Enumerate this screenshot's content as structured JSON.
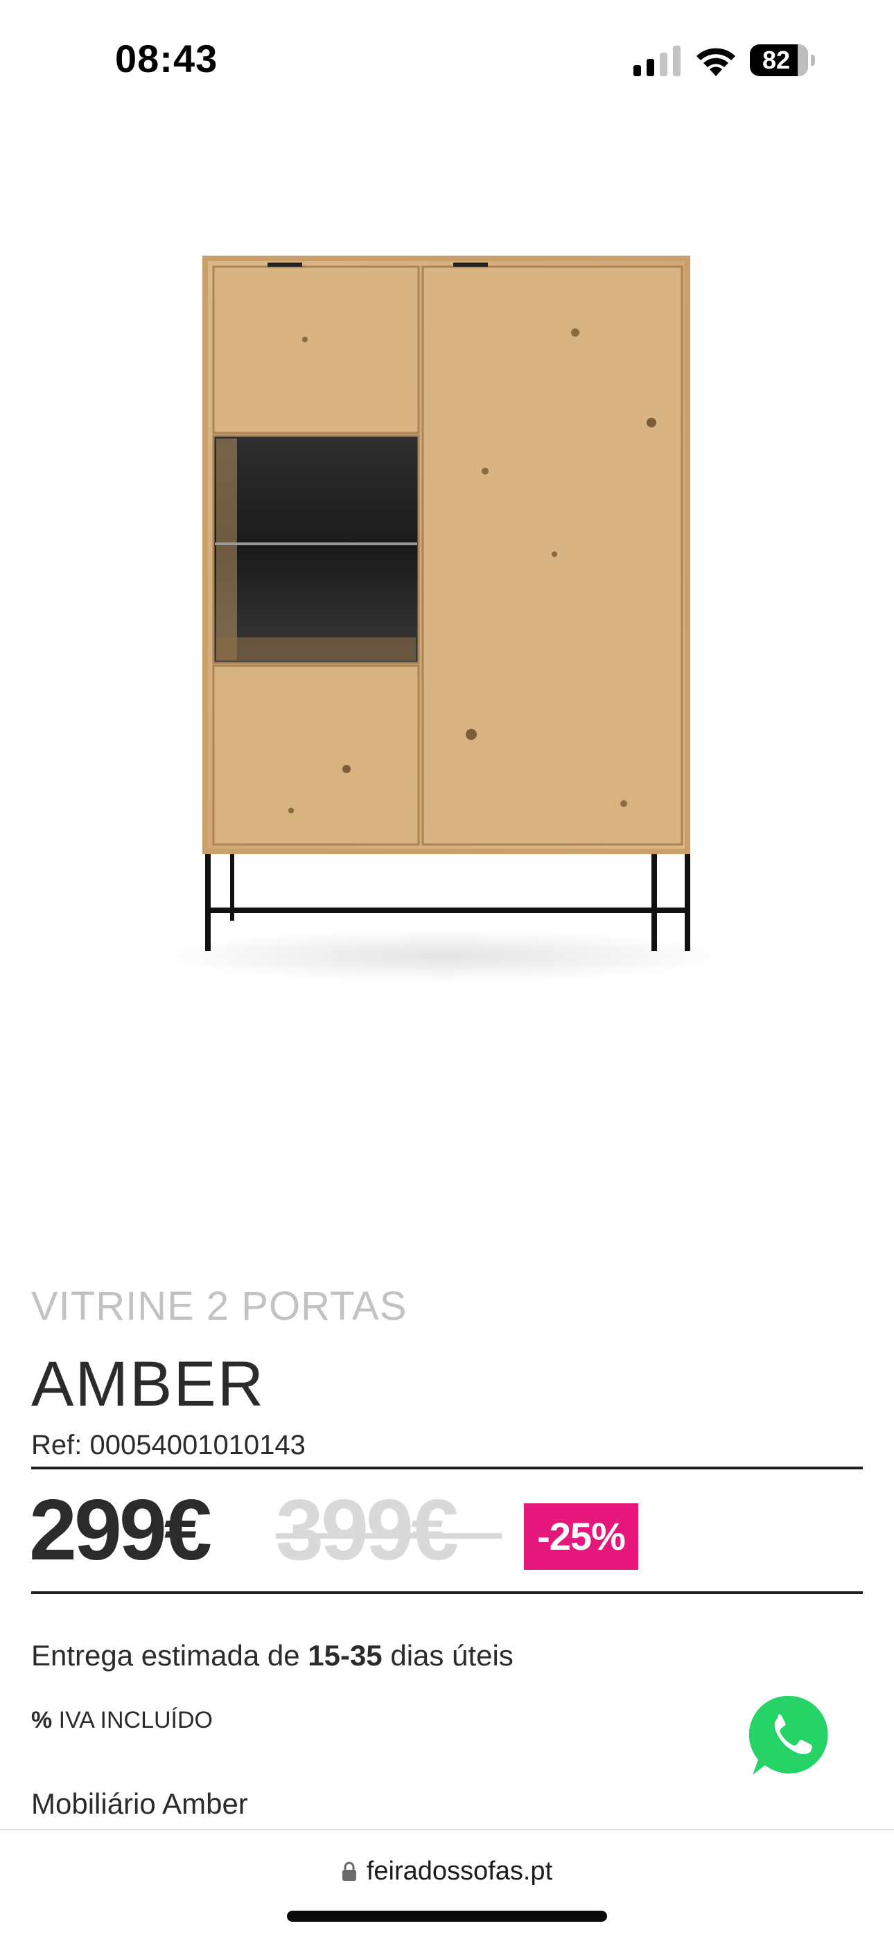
{
  "status_bar": {
    "time": "08:43",
    "battery": "82",
    "battery_level": 0.82,
    "icons": [
      "cellular-signal-icon",
      "wifi-icon",
      "battery-icon"
    ]
  },
  "product": {
    "image_subject": "cabinet-image",
    "category": "VITRINE 2 PORTAS",
    "name": "AMBER",
    "ref": "Ref: 00054001010143",
    "price": "299€",
    "old_price": "399€",
    "discount": "-25%",
    "delivery_prefix": "Entrega estimada de ",
    "delivery_days": "15-35",
    "delivery_suffix": " dias úteis",
    "iva_symbol": "%",
    "iva_text": " IVA INCLUÍDO",
    "collection": "Mobiliário Amber"
  },
  "colors": {
    "discount_badge": "#e5177b",
    "whatsapp": "#25d366",
    "old_price": "#d9d9d9",
    "category": "#c2c2c2",
    "wood": "#d7b07c",
    "text": "#2b2b2b"
  },
  "floating": {
    "whatsapp_icon": "whatsapp-icon"
  },
  "browser": {
    "url": "feiradossofas.pt",
    "lock_icon": "lock-icon"
  }
}
